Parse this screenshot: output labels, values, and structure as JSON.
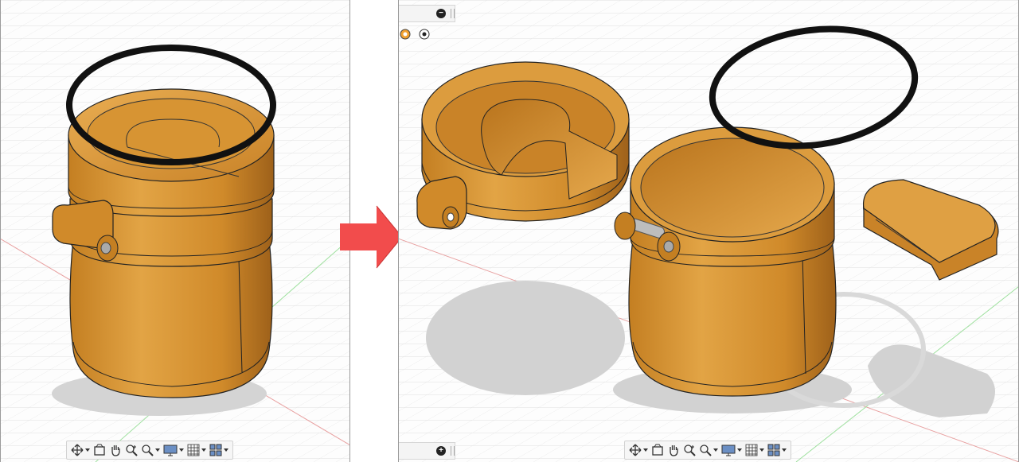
{
  "colors": {
    "body": "#d08a2a",
    "body_dark": "#a5661a",
    "body_light": "#e8a94a",
    "ring": "#111111",
    "grid": "#dcdcdc",
    "axis_red": "#e57b7b",
    "axis_green": "#7bd07b",
    "arrow": "#f24c4c",
    "shadow": "#d2d2d2"
  },
  "navbar_icons": [
    {
      "icon": "orbit-icon",
      "has_menu": true
    },
    {
      "icon": "look-at-icon",
      "has_menu": false
    },
    {
      "icon": "pan-hand-icon",
      "has_menu": false
    },
    {
      "icon": "zoom-icon",
      "has_menu": false
    },
    {
      "icon": "fit-zoom-icon",
      "has_menu": true
    },
    {
      "icon": "display-settings-icon",
      "has_menu": true
    },
    {
      "icon": "grid-settings-icon",
      "has_menu": true
    },
    {
      "icon": "viewports-icon",
      "has_menu": true
    }
  ],
  "browser": {
    "collapse_symbol": "−",
    "add_symbol": "+"
  }
}
